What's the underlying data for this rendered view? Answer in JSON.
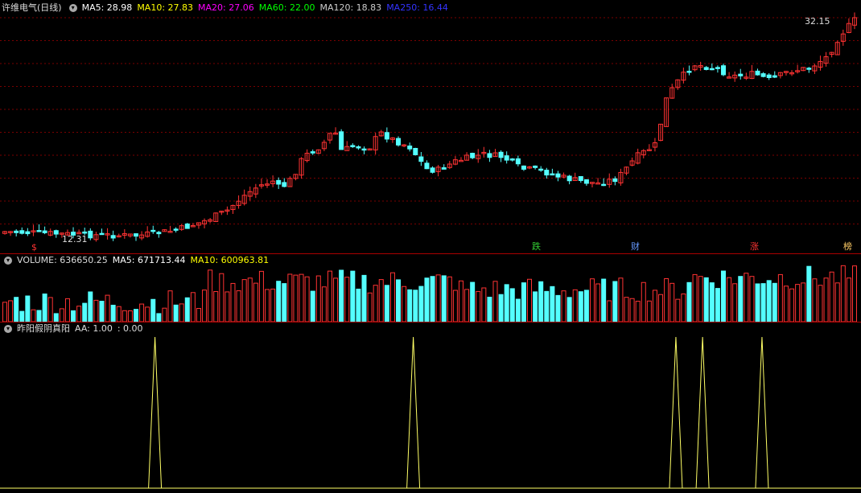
{
  "main": {
    "title": "许维电气(日线)",
    "ma_labels": [
      {
        "text": "MA5: 28.98",
        "color": "#ffffff"
      },
      {
        "text": "MA10: 27.83",
        "color": "#ffff00"
      },
      {
        "text": "MA20: 27.06",
        "color": "#ff00ff"
      },
      {
        "text": "MA60: 22.00",
        "color": "#00ff00"
      },
      {
        "text": "MA120: 18.83",
        "color": "#cccccc"
      },
      {
        "text": "MA250: 16.44",
        "color": "#3333ff"
      }
    ],
    "high_label": "32.15",
    "low_label": "12.31",
    "low_marker": "$",
    "markers": [
      {
        "text": "跌",
        "color": "#33cc33"
      },
      {
        "text": "财",
        "color": "#6699ff"
      },
      {
        "text": "涨",
        "color": "#ff3333"
      },
      {
        "text": "榜",
        "color": "#ffcc66"
      }
    ]
  },
  "volume": {
    "title": "VOLUME: 636650.25",
    "ma5": "MA5: 671713.44",
    "ma10": "MA10: 600963.81"
  },
  "indicator": {
    "title": "昨阳假阴真阳",
    "aa": "AA: 1.00",
    "zero": ": 0.00"
  },
  "colors": {
    "up": "#ff3333",
    "down": "#54ffff",
    "grid": "#7a0000",
    "bg": "#000000",
    "ma5": "#ffffff",
    "ma10": "#ffff00",
    "ma20": "#ff00ff",
    "ma60": "#00ff00",
    "ma120": "#cccccc",
    "ma250": "#3333ff",
    "signal": "#ffff66"
  },
  "chart_data": [
    {
      "type": "candlestick",
      "description_series": "daily OHLC candles with moving averages MA5, MA10, MA20, MA60, MA120, MA250",
      "price_high": 32.15,
      "price_low": 12.31
    },
    {
      "type": "bar",
      "series": [
        {
          "name": "VOLUME",
          "last": 636650.25
        },
        {
          "name": "MA5",
          "last": 671713.44
        },
        {
          "name": "MA10",
          "last": 600963.81
        }
      ]
    },
    {
      "type": "line",
      "series": [
        {
          "name": "AA",
          "values_signal": [
            0,
            1
          ]
        }
      ],
      "signal_positions_fraction": [
        0.18,
        0.48,
        0.785,
        0.816,
        0.885
      ]
    }
  ]
}
